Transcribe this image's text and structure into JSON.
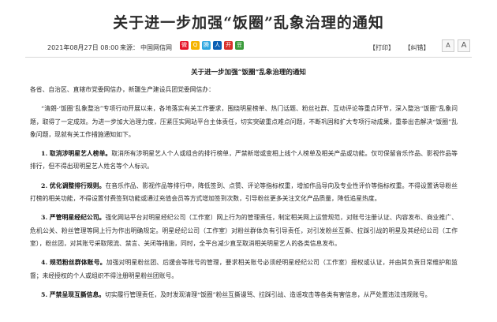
{
  "header": {
    "title": "关于进一步加强“饭圈”乱象治理的通知",
    "date": "2021年08月27日 08:00",
    "source_label": "来源：",
    "source": "中国网信网",
    "print_label": "【打印】",
    "close_label": "【纠错】",
    "font_larger": "A",
    "font_smaller": "A"
  },
  "share_icons": [
    {
      "name": "weibo-icon",
      "color": "#e6162d",
      "glyph": "微"
    },
    {
      "name": "qzone-icon",
      "color": "#f5b400",
      "glyph": "Q"
    },
    {
      "name": "tencent-weibo-icon",
      "color": "#2ea7e0",
      "glyph": "腾"
    },
    {
      "name": "renren-icon",
      "color": "#0a5fb4",
      "glyph": "人"
    },
    {
      "name": "kaixin-icon",
      "color": "#d9302a",
      "glyph": "开"
    },
    {
      "name": "douban-icon",
      "color": "#3a9b3a",
      "glyph": "豆"
    }
  ],
  "doc": {
    "title": "关于进一步加强“饭圈”乱象治理的通知",
    "salutation": "各省、自治区、直辖市党委网信办，新疆生产建设兵团党委网信办：",
    "intro": "“清朗·‘饭圈’乱象整治”专项行动开展以来，各地落实有关工作要求，围绕明星榜单、热门话题、粉丝社群、互动评论等重点环节，深入整治“饭圈”乱象问题，取得了一定成效。为进一步加大治理力度，压紧压实网站平台主体责任，切实突破重点难点问题，不断巩固和扩大专项行动成果，重拳出击解决“饭圈”乱象问题，现就有关工作措施通知如下。",
    "items": [
      {
        "head": "1. 取消涉明星艺人榜单。",
        "text": "取消所有涉明星艺人个人或组合的排行榜单，严禁新增或变相上线个人榜单及相关产品或功能。仅可保留音乐作品、影视作品等排行，但不得出现明星艺人姓名等个人标识。"
      },
      {
        "head": "2. 优化调整排行规则。",
        "text": "在音乐作品、影视作品等排行中，降低签到、点赞、评论等指标权重，增加作品导向及专业性评价等指标权重。不得设置诱导粉丝打榜的相关功能，不得设置付费签到功能或通过充值会员等方式增加签到次数，引导粉丝更多关注文化产品质量，降低追星热度。"
      },
      {
        "head": "3. 严管明星经纪公司。",
        "text": "强化网站平台对明星经纪公司（工作室）网上行为的管理责任，制定相关网上运营规范，对账号注册认证、内容发布、商业推广、危机公关、粉丝管理等网上行为作出明确规定。明星经纪公司（工作室）对粉丝群体负有引导责任，对引发粉丝互撕、拉踩引战的明星及其经纪公司（工作室），粉丝团，对其账号采取限流、禁言、关闭等措施，同时，全平台减少直至取消相关明星艺人的各类信息发布。"
      },
      {
        "head": "4. 规范粉丝群体账号。",
        "text": "加强对明星粉丝团、后援会等账号的管理，要求相关账号必须经明星经纪公司（工作室）授权或认证，并由其负责日常维护和监督；未经授权的个人或组织不得注册明星粉丝团账号。"
      },
      {
        "head": "5. 严禁呈现互撕信息。",
        "text": "切实履行管理责任，及时发现清理“饭圈”粉丝互撕谩骂、拉踩引战、造谣攻击等各类有害信息，从严处置违法违规账号。"
      }
    ]
  }
}
